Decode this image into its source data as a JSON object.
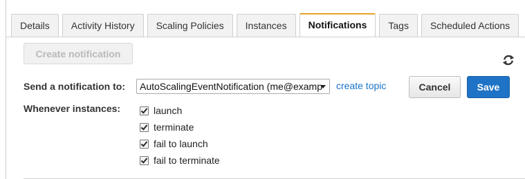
{
  "tabs": [
    {
      "label": "Details",
      "active": false
    },
    {
      "label": "Activity History",
      "active": false
    },
    {
      "label": "Scaling Policies",
      "active": false
    },
    {
      "label": "Instances",
      "active": false
    },
    {
      "label": "Notifications",
      "active": true
    },
    {
      "label": "Tags",
      "active": false
    },
    {
      "label": "Scheduled Actions",
      "active": false
    }
  ],
  "toolbar": {
    "create_notification_label": "Create notification",
    "refresh_icon": "refresh-icon"
  },
  "form": {
    "send_label": "Send a notification to:",
    "topic_value": "AutoScalingEventNotification (me@examp",
    "create_topic_link": "create topic",
    "cancel_label": "Cancel",
    "save_label": "Save",
    "whenever_label": "Whenever instances:",
    "events": [
      {
        "label": "launch",
        "checked": true
      },
      {
        "label": "terminate",
        "checked": true
      },
      {
        "label": "fail to launch",
        "checked": true
      },
      {
        "label": "fail to terminate",
        "checked": true
      }
    ]
  },
  "colors": {
    "active_tab_accent": "#e8a52a",
    "save_button": "#1f73c6",
    "link": "#1a73c8"
  }
}
